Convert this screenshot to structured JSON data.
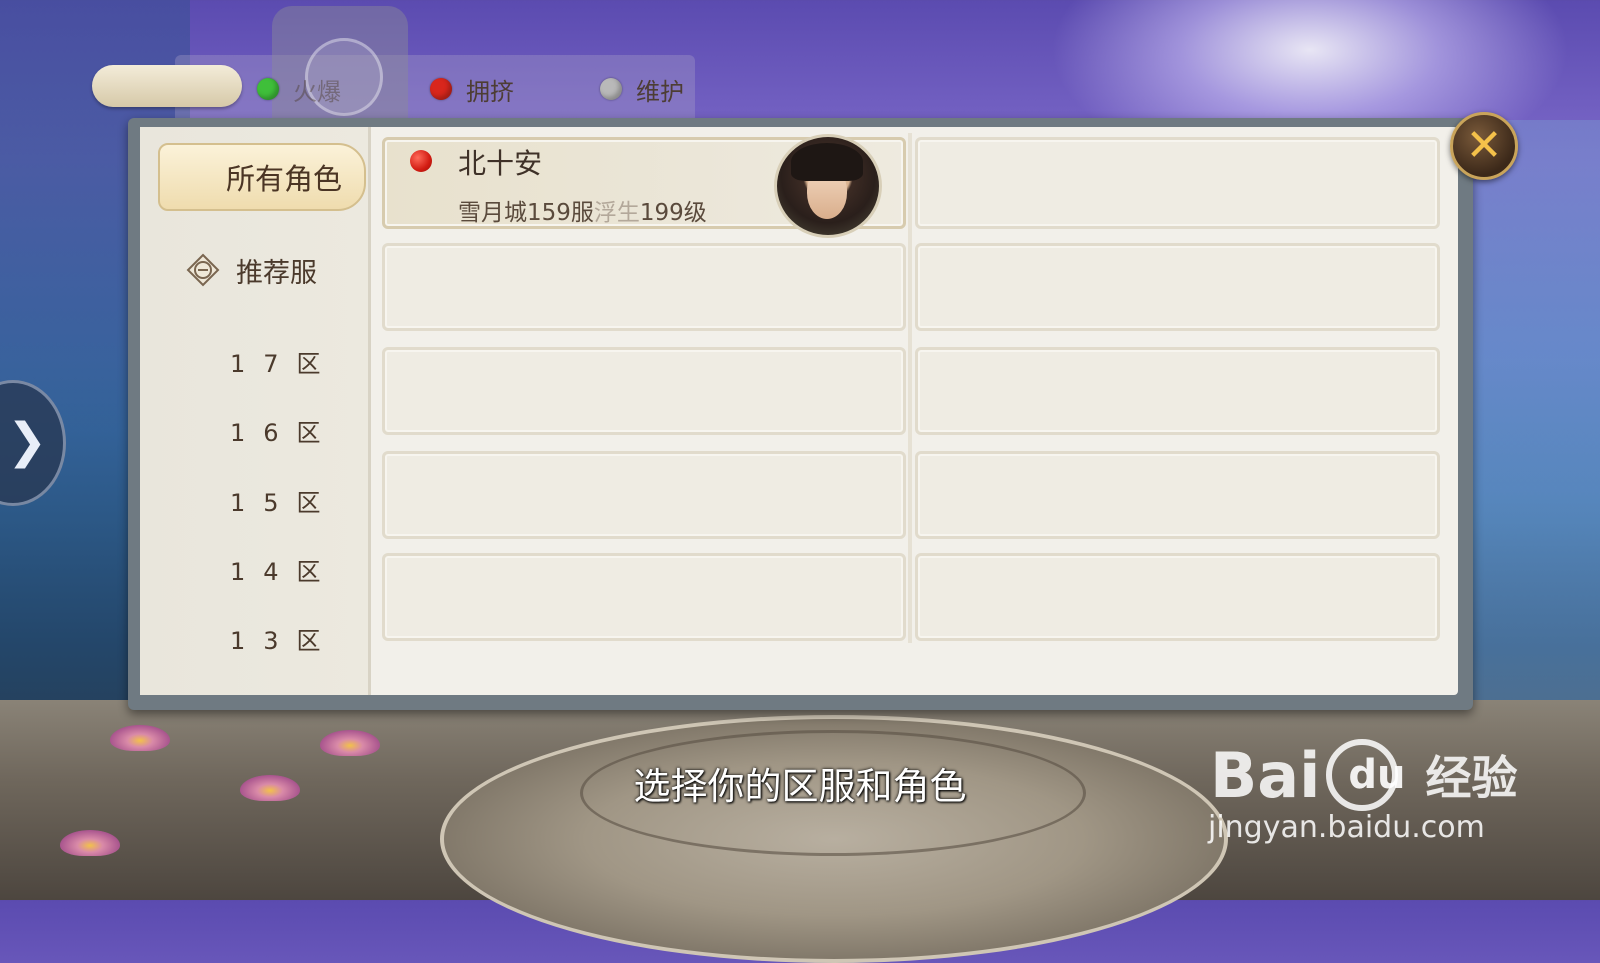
{
  "status_legend": [
    {
      "label": "火爆",
      "color": "#3fbf3a"
    },
    {
      "label": "拥挤",
      "color": "#d8261c"
    },
    {
      "label": "维护",
      "color": "#b9b9b9"
    }
  ],
  "sidebar": {
    "active_tab": "所有角色",
    "recommended_tab": "推荐服",
    "zones": [
      "17区",
      "16区",
      "15区",
      "14区",
      "13区"
    ]
  },
  "character": {
    "name": "北十安",
    "server": "雪月城159服",
    "rebirth": "浮生",
    "level": "199级",
    "status_color": "#d8261c"
  },
  "subtitle": "选择你的区服和角色",
  "watermark": {
    "logo_text": "Bai",
    "logo_du": "du",
    "logo_cn": "经验",
    "url": "jingyan.baidu.com"
  },
  "icons": {
    "close": "close-icon",
    "expand": "chevron-right-icon",
    "recommend": "recommend-badge-icon"
  }
}
